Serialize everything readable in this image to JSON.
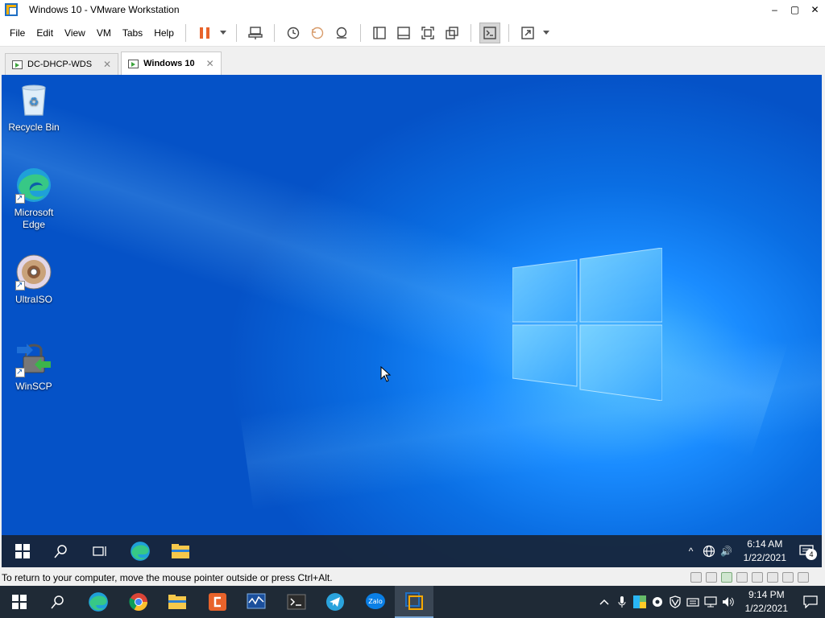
{
  "window": {
    "title": "Windows 10 - VMware Workstation",
    "minimize": "–",
    "maximize": "▢",
    "close": "✕"
  },
  "menu": {
    "items": [
      "File",
      "Edit",
      "View",
      "VM",
      "Tabs",
      "Help"
    ]
  },
  "tabs": [
    {
      "label": "DC-DHCP-WDS",
      "close": "✕"
    },
    {
      "label": "Windows 10",
      "close": "✕"
    }
  ],
  "desktop": {
    "icons": [
      {
        "label": "Recycle Bin"
      },
      {
        "label": "Microsoft Edge"
      },
      {
        "label": "UltraISO"
      },
      {
        "label": "WinSCP"
      }
    ]
  },
  "guest_taskbar": {
    "time": "6:14 AM",
    "date": "1/22/2021",
    "notification_count": "4",
    "up_chevron": "^",
    "speaker_icon": "🔊"
  },
  "status": {
    "message": "To return to your computer, move the mouse pointer outside or press Ctrl+Alt."
  },
  "host_taskbar": {
    "time": "9:14 PM",
    "date": "1/22/2021",
    "zalo_label": "Zalo"
  },
  "colors": {
    "desktop_blue": "#0a6ee3",
    "taskbar_dark": "#1f2a36",
    "accent_orange": "#e8632b"
  }
}
